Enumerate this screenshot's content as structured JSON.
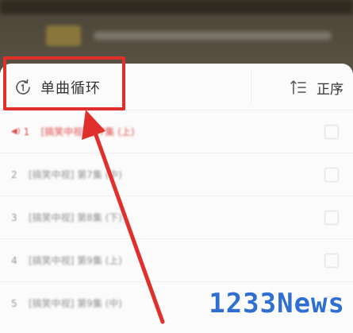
{
  "colors": {
    "accent_red": "#e0302c",
    "playing_red": "#e04a4a",
    "watermark_blue": "#2e6fd1",
    "sheet_bg": "#fbfbfb"
  },
  "playlist": {
    "mode_label": "单曲循环",
    "mode_icon": "repeat-one-icon",
    "order_label": "正序",
    "order_icon": "sort-ascending-icon",
    "rows": [
      {
        "num": "1",
        "title": "[搞笑中视] 第7集 (上)",
        "active": true
      },
      {
        "num": "2",
        "title": "[搞笑中视] 第7集 (中)",
        "active": false
      },
      {
        "num": "3",
        "title": "[搞笑中视] 第8集 (下)",
        "active": false
      },
      {
        "num": "4",
        "title": "[搞笑中视] 第9集 (上)",
        "active": false
      },
      {
        "num": "5",
        "title": "[搞笑中视] 第9集 (中)",
        "active": false
      }
    ]
  },
  "watermark": "1233News"
}
